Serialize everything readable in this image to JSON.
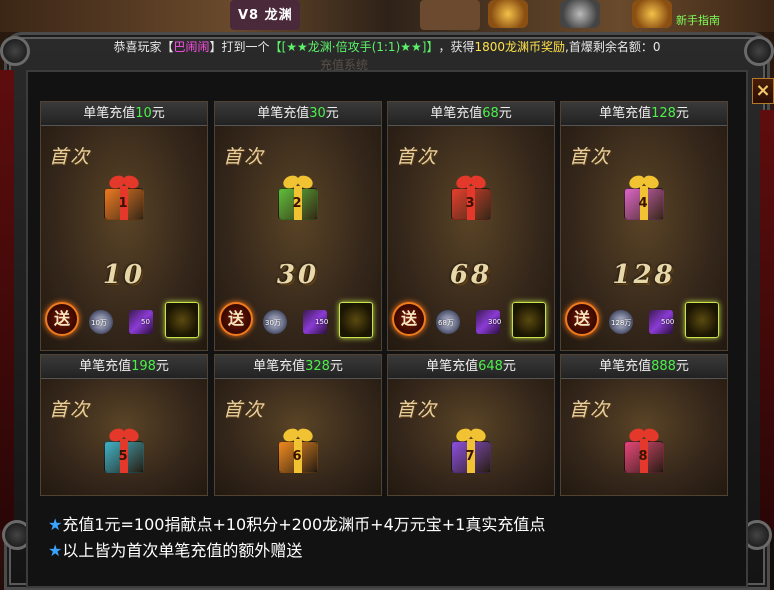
{
  "top_bar": {
    "player_name": "V8 龙渊",
    "right_icon_label": "新手指南"
  },
  "banner": {
    "prefix": "恭喜玩家【",
    "player": "巴闹闹",
    "mid": "】打到一个",
    "item": "【[★★龙渊·倍攻手(1:1)★★]】",
    "reward_pre": "，获得",
    "reward": "1800龙渊币奖励",
    "tail": ",首爆剩余名额：0"
  },
  "panel": {
    "title": "充值系统",
    "close_label": "×"
  },
  "cards": [
    {
      "header_prefix": "单笔充值",
      "amount": "10",
      "unit": "元",
      "first": "首次",
      "gift_no": "1",
      "big": "10",
      "send": "送",
      "coin": "10万",
      "gem": "50",
      "color": "#f07a22"
    },
    {
      "header_prefix": "单笔充值",
      "amount": "30",
      "unit": "元",
      "first": "首次",
      "gift_no": "2",
      "big": "30",
      "send": "送",
      "coin": "30万",
      "gem": "150",
      "color": "#5fbf3a"
    },
    {
      "header_prefix": "单笔充值",
      "amount": "68",
      "unit": "元",
      "first": "首次",
      "gift_no": "3",
      "big": "68",
      "send": "送",
      "coin": "68万",
      "gem": "300",
      "color": "#e8402e"
    },
    {
      "header_prefix": "单笔充值",
      "amount": "128",
      "unit": "元",
      "first": "首次",
      "gift_no": "4",
      "big": "128",
      "send": "送",
      "coin": "128万",
      "gem": "500",
      "color": "#e066c9"
    },
    {
      "header_prefix": "单笔充值",
      "amount": "198",
      "unit": "元",
      "first": "首次",
      "gift_no": "5",
      "color": "#3fb3c9"
    },
    {
      "header_prefix": "单笔充值",
      "amount": "328",
      "unit": "元",
      "first": "首次",
      "gift_no": "6",
      "color": "#f08a1f"
    },
    {
      "header_prefix": "单笔充值",
      "amount": "648",
      "unit": "元",
      "first": "首次",
      "gift_no": "7",
      "color": "#8b4fe0"
    },
    {
      "header_prefix": "单笔充值",
      "amount": "888",
      "unit": "元",
      "first": "首次",
      "gift_no": "8",
      "color": "#e8457a"
    }
  ],
  "info": {
    "star": "★",
    "line1": "充值1元=100捐献点+10积分+200龙渊币+4万元宝+1真实充值点",
    "line2": "以上皆为首次单笔充值的额外赠送"
  },
  "colors": {
    "amount_green": "#4cf04a",
    "gold_bow": "#f1c232",
    "red_bow": "#e3382a"
  }
}
